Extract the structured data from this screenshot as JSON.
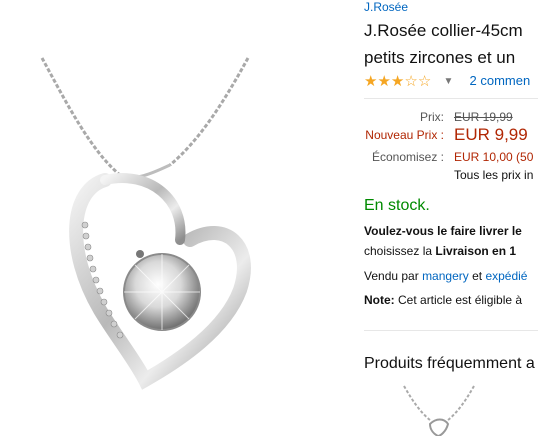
{
  "product": {
    "brand": "J.Rosée",
    "title_line1": "J.Rosée collier-45cm",
    "title_line2": "petits zircones et un"
  },
  "rating": {
    "stars": 3,
    "max_stars": 5,
    "full_star_glyph": "★",
    "empty_star_glyph": "☆",
    "caret_glyph": "▼",
    "reviews_text": "2 commen"
  },
  "pricing": {
    "list_label": "Prix:",
    "list_price": "EUR 19,99",
    "new_label": "Nouveau Prix :",
    "new_price": "EUR 9,99",
    "savings_label": "Économisez :",
    "savings_value": "EUR 10,00 (50",
    "taxes_note": "Tous les prix in"
  },
  "availability": {
    "stock_text": "En stock."
  },
  "shipping": {
    "line1": "Voulez-vous le faire livrer le",
    "line2_prefix": "choisissez la ",
    "line2_bold": "Livraison en 1"
  },
  "seller": {
    "prefix": "Vendu par ",
    "name": "mangery",
    "mid": " et ",
    "fulfilled": "expédié"
  },
  "note": {
    "label": "Note:",
    "text": " Cet article est éligible à"
  },
  "fbt": {
    "heading": "Produits fréquemment a"
  },
  "colors": {
    "link": "#0066c0",
    "price": "#b12704",
    "stock": "#008a00",
    "star": "#f5a623"
  }
}
